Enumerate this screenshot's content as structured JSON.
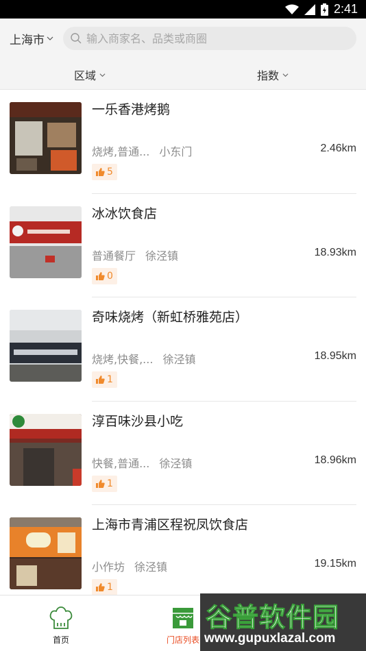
{
  "status_bar": {
    "time": "2:41"
  },
  "header": {
    "city": "上海市",
    "search_placeholder": "输入商家名、品类或商圈"
  },
  "filters": {
    "area": "区域",
    "index": "指数"
  },
  "stores": [
    {
      "name": "一乐香港烤鹅",
      "category": "烧烤,普通...",
      "district": "小东门",
      "distance": "2.46km",
      "likes": "5"
    },
    {
      "name": "冰冰饮食店",
      "category": "普通餐厅",
      "district": "徐泾镇",
      "distance": "18.93km",
      "likes": "0"
    },
    {
      "name": "奇味烧烤（新虹桥雅苑店）",
      "category": "烧烤,快餐,...",
      "district": "徐泾镇",
      "distance": "18.95km",
      "likes": "1"
    },
    {
      "name": "淳百味沙县小吃",
      "category": "快餐,普通...",
      "district": "徐泾镇",
      "distance": "18.96km",
      "likes": "1"
    },
    {
      "name": "上海市青浦区程祝凤饮食店",
      "category": "小作坊",
      "district": "徐泾镇",
      "distance": "19.15km",
      "likes": "1"
    }
  ],
  "tabbar": {
    "home_label": "首页",
    "stores_label": "门店列表",
    "active_color": "#e94b21"
  },
  "watermark": {
    "title": "谷普软件园",
    "url": "www.gupuxlazal.com"
  },
  "colors": {
    "accent": "#f08a2c",
    "header_bg": "#f4f4f4"
  }
}
